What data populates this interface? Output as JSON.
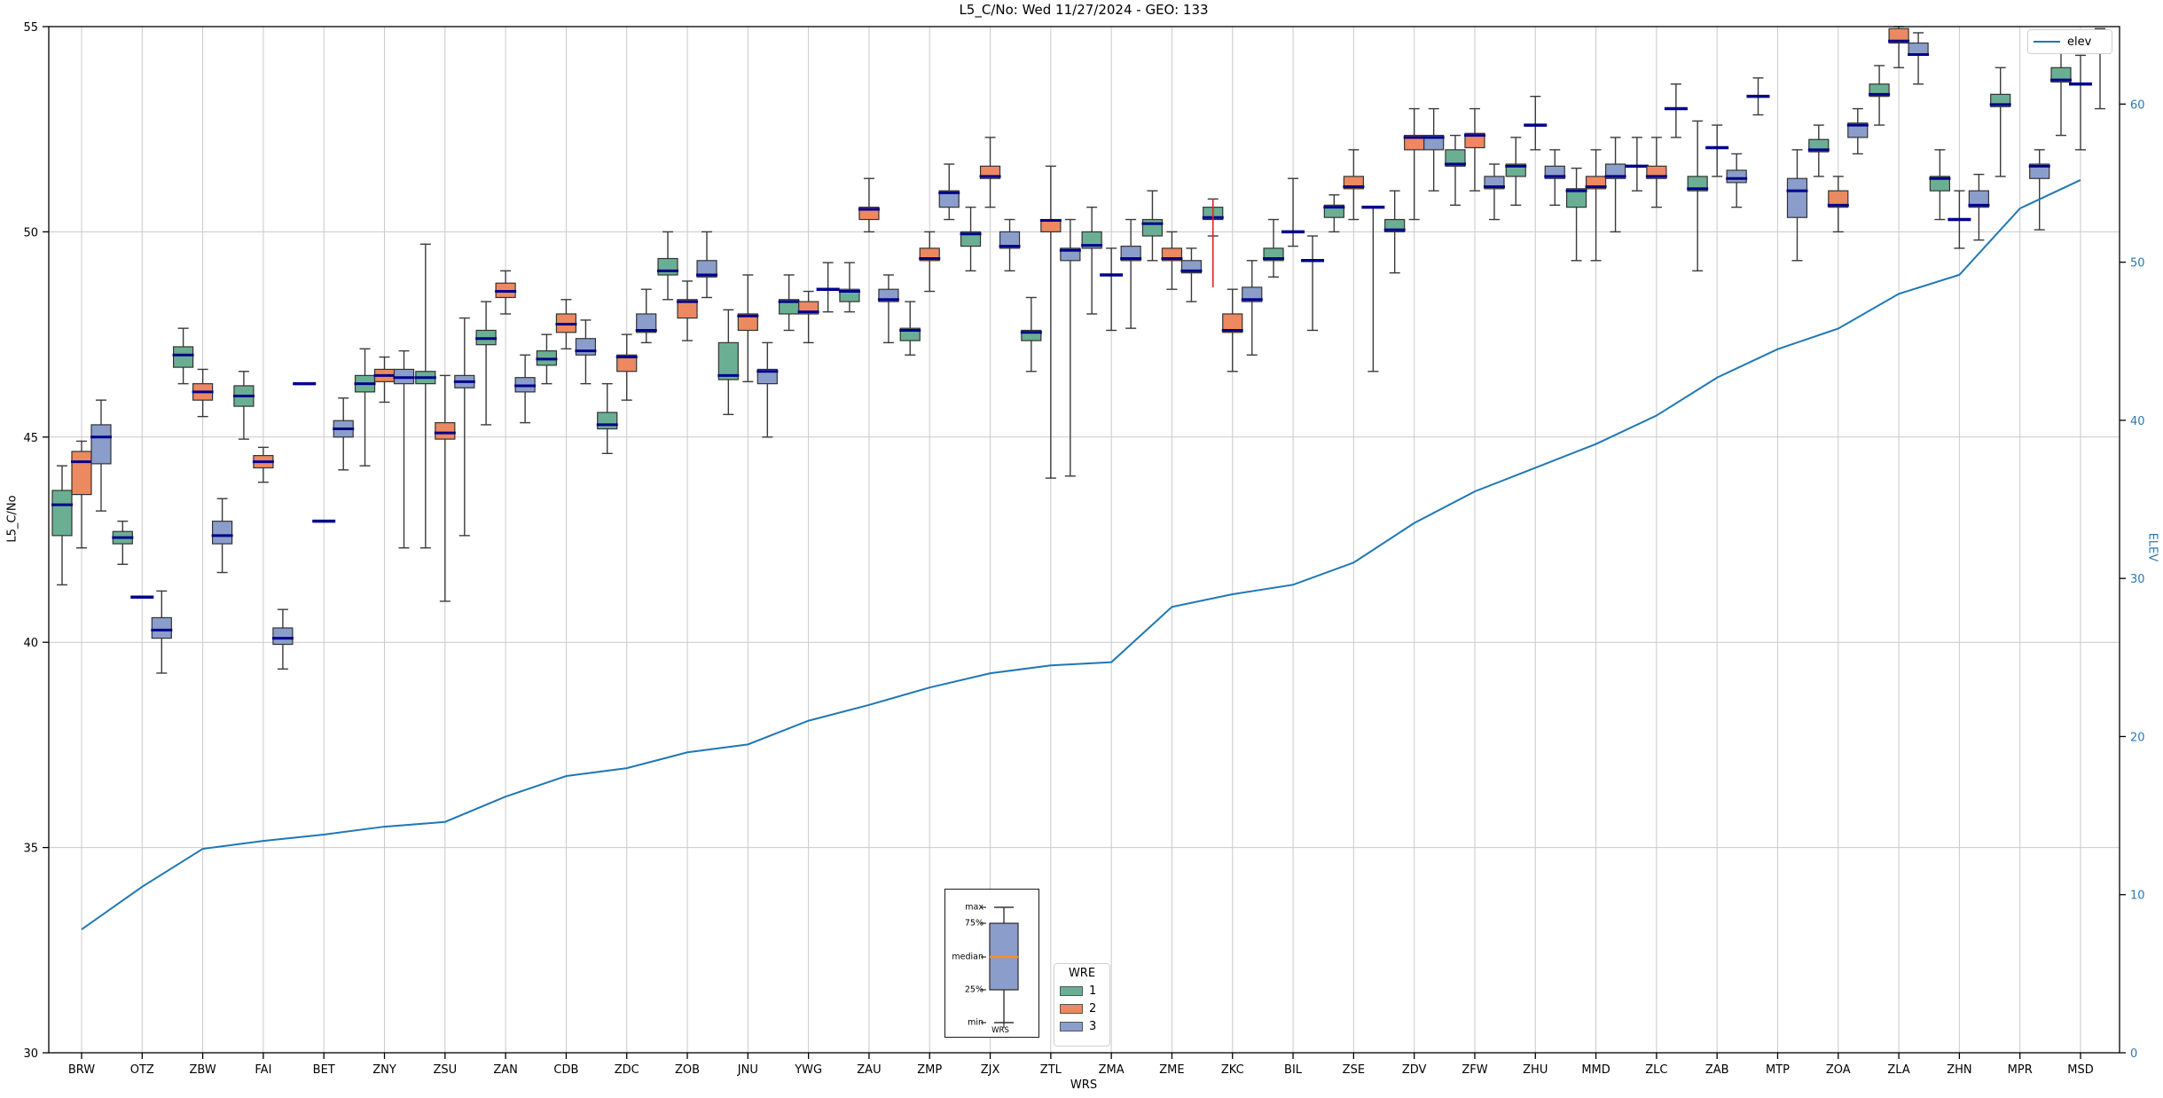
{
  "title": "L5_C/No: Wed 11/27/2024 - GEO: 133",
  "axes": {
    "left": {
      "label": "L5_C/No",
      "ticks": [
        55,
        50,
        45,
        40,
        35,
        30
      ],
      "range": [
        30,
        55
      ],
      "gridlines_at": [
        35,
        40,
        45,
        50
      ]
    },
    "right": {
      "label": "ELEV",
      "ticks": [
        60,
        50,
        40,
        30,
        20,
        10,
        0
      ],
      "range": [
        0,
        64.9
      ],
      "tick_color": "#2878b5"
    },
    "x": {
      "label": "WRS"
    }
  },
  "legend_elev": {
    "label": "elev",
    "color": "#1f77b4"
  },
  "wre_legend": {
    "title": "WRE",
    "entries": [
      {
        "label": "1",
        "color": "#6aaf93"
      },
      {
        "label": "2",
        "color": "#ec8960"
      },
      {
        "label": "3",
        "color": "#8b9dca"
      }
    ]
  },
  "inset": {
    "labels": [
      "max",
      "75%",
      "median",
      "25%",
      "min"
    ],
    "xlabel": "WRS",
    "box_color": "#8b9dca",
    "median_color": "#ff8c1a"
  },
  "colors": {
    "median": "#00008b",
    "box_edge": "#333333",
    "whisker": "#3a3a3a",
    "grid": "#c9c9c9",
    "annotation_red": "#e52222",
    "elev_line": "#1f77b4"
  },
  "chart_data": {
    "type": "boxplot+line",
    "title": "L5_C/No: Wed 11/27/2024 - GEO: 133",
    "xlabel": "WRS",
    "ylabel_left": "L5_C/No",
    "ylabel_right": "ELEV",
    "ylim_left": [
      30,
      55
    ],
    "ylim_right": [
      0,
      64.9
    ],
    "box_stats_format": "[lo_whisker, q1, median, q3, hi_whisker] or [lo_whisker, median, hi_whisker] for flat (degenerate) boxes",
    "wre_series": [
      "1",
      "2",
      "3"
    ],
    "stations": [
      {
        "name": "BRW",
        "elev": 7.8,
        "wre1": [
          41.4,
          42.6,
          43.35,
          43.7,
          44.3
        ],
        "wre2": [
          42.3,
          43.6,
          44.4,
          44.65,
          44.9
        ],
        "wre3": [
          43.2,
          44.35,
          45.0,
          45.3,
          45.9
        ]
      },
      {
        "name": "OTZ",
        "elev": 10.5,
        "wre1": [
          41.9,
          42.4,
          42.55,
          42.7,
          42.95
        ],
        "wre2": [
          41.1,
          41.1,
          41.1
        ],
        "wre3": [
          39.25,
          40.1,
          40.3,
          40.6,
          41.25
        ]
      },
      {
        "name": "ZBW",
        "elev": 12.9,
        "wre1": [
          46.3,
          46.7,
          47.0,
          47.2,
          47.65
        ],
        "wre2": [
          45.5,
          45.9,
          46.1,
          46.3,
          46.65
        ],
        "wre3": [
          41.7,
          42.4,
          42.6,
          42.95,
          43.5
        ]
      },
      {
        "name": "FAI",
        "elev": 13.4,
        "wre1": [
          44.95,
          45.75,
          46.0,
          46.25,
          46.6
        ],
        "wre2": [
          43.9,
          44.25,
          44.4,
          44.55,
          44.75
        ],
        "wre3": [
          39.35,
          39.95,
          40.1,
          40.35,
          40.8
        ]
      },
      {
        "name": "BET",
        "elev": 13.8,
        "wre1": [
          46.3,
          46.3,
          46.3
        ],
        "wre2": [
          42.95,
          42.95,
          42.95
        ],
        "wre3": [
          44.2,
          45.0,
          45.2,
          45.4,
          45.95
        ]
      },
      {
        "name": "ZNY",
        "elev": 14.3,
        "wre1": [
          44.3,
          46.1,
          46.3,
          46.5,
          47.15
        ],
        "wre2": [
          45.85,
          46.35,
          46.5,
          46.65,
          46.95
        ],
        "wre3": [
          42.3,
          46.3,
          46.45,
          46.65,
          47.1
        ]
      },
      {
        "name": "ZSU",
        "elev": 14.6,
        "wre1": [
          42.3,
          46.3,
          46.45,
          46.6,
          49.7
        ],
        "wre2": [
          41.0,
          44.95,
          45.1,
          45.35,
          46.5
        ],
        "wre3": [
          42.6,
          46.2,
          46.35,
          46.5,
          47.9
        ]
      },
      {
        "name": "ZAN",
        "elev": 16.2,
        "wre1": [
          45.3,
          47.25,
          47.4,
          47.6,
          48.3
        ],
        "wre2": [
          48.0,
          48.4,
          48.55,
          48.75,
          49.05
        ],
        "wre3": [
          45.35,
          46.1,
          46.25,
          46.45,
          47.0
        ]
      },
      {
        "name": "CDB",
        "elev": 17.5,
        "wre1": [
          46.3,
          46.75,
          46.9,
          47.1,
          47.5
        ],
        "wre2": [
          47.15,
          47.55,
          47.75,
          48.0,
          48.35
        ],
        "wre3": [
          46.3,
          47.0,
          47.1,
          47.4,
          47.85
        ]
      },
      {
        "name": "ZDC",
        "elev": 18.0,
        "wre1": [
          44.6,
          45.2,
          45.3,
          45.6,
          46.3
        ],
        "wre2": [
          45.9,
          46.6,
          46.95,
          47.0,
          47.5
        ],
        "wre3": [
          47.3,
          47.55,
          47.6,
          48.0,
          48.6
        ]
      },
      {
        "name": "ZOB",
        "elev": 19.0,
        "wre1": [
          48.35,
          48.95,
          49.05,
          49.35,
          50.0
        ],
        "wre2": [
          47.35,
          47.9,
          48.3,
          48.35,
          48.8
        ],
        "wre3": [
          48.4,
          48.9,
          48.95,
          49.3,
          50.0
        ]
      },
      {
        "name": "JNU",
        "elev": 19.5,
        "wre1": [
          45.55,
          46.4,
          46.5,
          47.3,
          48.1
        ],
        "wre2": [
          46.35,
          47.6,
          47.95,
          48.0,
          48.95
        ],
        "wre3": [
          45.0,
          46.3,
          46.6,
          46.65,
          47.3
        ]
      },
      {
        "name": "YWG",
        "elev": 21.0,
        "wre1": [
          47.6,
          48.0,
          48.3,
          48.35,
          48.95
        ],
        "wre2": [
          47.3,
          48.0,
          48.05,
          48.3,
          48.55
        ],
        "wre3": [
          48.05,
          48.6,
          49.25
        ]
      },
      {
        "name": "ZAU",
        "elev": 22.0,
        "wre1": [
          48.05,
          48.3,
          48.55,
          48.6,
          49.25
        ],
        "wre2": [
          50.0,
          50.3,
          50.55,
          50.6,
          51.3
        ],
        "wre3": [
          47.3,
          48.3,
          48.35,
          48.6,
          48.95
        ]
      },
      {
        "name": "ZMP",
        "elev": 23.1,
        "wre1": [
          47.0,
          47.35,
          47.6,
          47.65,
          48.3
        ],
        "wre2": [
          48.55,
          49.3,
          49.35,
          49.6,
          50.0
        ],
        "wre3": [
          50.3,
          50.6,
          50.95,
          51.0,
          51.65
        ]
      },
      {
        "name": "ZJX",
        "elev": 24.0,
        "wre1": [
          49.05,
          49.65,
          49.95,
          50.0,
          50.6
        ],
        "wre2": [
          50.6,
          51.3,
          51.35,
          51.6,
          52.3
        ],
        "wre3": [
          49.05,
          49.6,
          49.65,
          50.0,
          50.3
        ]
      },
      {
        "name": "ZTL",
        "elev": 24.5,
        "wre1": [
          46.6,
          47.35,
          47.55,
          47.6,
          48.4
        ],
        "wre2": [
          44.0,
          50.0,
          50.28,
          50.3,
          51.6
        ],
        "wre3": [
          44.05,
          49.3,
          49.55,
          49.6,
          50.3
        ]
      },
      {
        "name": "ZMA",
        "elev": 24.7,
        "wre1": [
          48.0,
          49.6,
          49.67,
          50.0,
          50.6
        ],
        "wre2": [
          47.6,
          48.95,
          49.6
        ],
        "wre3": [
          47.65,
          49.3,
          49.35,
          49.65,
          50.3
        ]
      },
      {
        "name": "ZME",
        "elev": 28.2,
        "wre1": [
          49.3,
          49.9,
          50.2,
          50.3,
          51.0
        ],
        "wre2": [
          48.6,
          49.3,
          49.35,
          49.6,
          50.0
        ],
        "wre3": [
          48.3,
          49.0,
          49.05,
          49.3,
          49.6
        ]
      },
      {
        "name": "ZKC",
        "elev": 29.0,
        "wre1": [
          49.9,
          50.3,
          50.35,
          50.6,
          50.8
        ],
        "wre2": [
          46.6,
          47.55,
          47.6,
          48.0,
          48.6
        ],
        "wre3": [
          47.0,
          48.3,
          48.35,
          48.65,
          49.3
        ]
      },
      {
        "name": "BIL",
        "elev": 29.6,
        "wre1": [
          48.9,
          49.3,
          49.35,
          49.6,
          50.3
        ],
        "wre2": [
          49.65,
          50.0,
          51.3
        ],
        "wre3": [
          47.6,
          49.3,
          49.9
        ]
      },
      {
        "name": "ZSE",
        "elev": 31.0,
        "wre1": [
          50.0,
          50.35,
          50.6,
          50.65,
          50.9
        ],
        "wre2": [
          50.3,
          51.05,
          51.1,
          51.35,
          52.0
        ],
        "wre3": [
          46.6,
          50.6,
          50.6
        ]
      },
      {
        "name": "ZDV",
        "elev": 33.5,
        "wre1": [
          49.0,
          50.0,
          50.05,
          50.3,
          51.0
        ],
        "wre2": [
          50.3,
          52.0,
          52.3,
          52.35,
          53.0
        ],
        "wre3": [
          51.0,
          52.0,
          52.3,
          52.35,
          53.0
        ]
      },
      {
        "name": "ZFW",
        "elev": 35.5,
        "wre1": [
          50.65,
          51.6,
          51.65,
          52.0,
          52.35
        ],
        "wre2": [
          51.0,
          52.05,
          52.35,
          52.4,
          53.0
        ],
        "wre3": [
          50.3,
          51.05,
          51.1,
          51.35,
          51.65
        ]
      },
      {
        "name": "ZHU",
        "elev": 37.0,
        "wre1": [
          50.65,
          51.35,
          51.6,
          51.65,
          52.3
        ],
        "wre2": [
          52.0,
          52.6,
          53.3
        ],
        "wre3": [
          50.65,
          51.3,
          51.35,
          51.6,
          52.0
        ]
      },
      {
        "name": "MMD",
        "elev": 38.5,
        "wre1": [
          49.3,
          50.6,
          51.0,
          51.05,
          51.55
        ],
        "wre2": [
          49.3,
          51.05,
          51.1,
          51.35,
          52.0
        ],
        "wre3": [
          50.0,
          51.3,
          51.35,
          51.65,
          52.3
        ]
      },
      {
        "name": "ZLC",
        "elev": 40.3,
        "wre1": [
          51.0,
          51.6,
          52.3
        ],
        "wre2": [
          50.6,
          51.3,
          51.35,
          51.6,
          52.3
        ],
        "wre3": [
          52.3,
          53.0,
          53.6
        ]
      },
      {
        "name": "ZAB",
        "elev": 42.7,
        "wre1": [
          49.05,
          51.0,
          51.05,
          51.35,
          52.7
        ],
        "wre2": [
          51.35,
          52.05,
          52.6
        ],
        "wre3": [
          50.6,
          51.2,
          51.3,
          51.5,
          51.9
        ]
      },
      {
        "name": "MTP",
        "elev": 44.5,
        "wre1": [
          52.85,
          53.3,
          53.75
        ],
        "wre2": null,
        "wre3": [
          49.3,
          50.35,
          51.0,
          51.3,
          52.0
        ]
      },
      {
        "name": "ZOA",
        "elev": 45.8,
        "wre1": [
          51.35,
          51.95,
          52.0,
          52.25,
          52.6
        ],
        "wre2": [
          50.0,
          50.6,
          50.65,
          51.0,
          51.35
        ],
        "wre3": [
          51.9,
          52.3,
          52.6,
          52.65,
          53.0
        ]
      },
      {
        "name": "ZLA",
        "elev": 48.0,
        "wre1": [
          52.6,
          53.3,
          53.35,
          53.6,
          54.05
        ],
        "wre2": [
          54.0,
          54.6,
          54.65,
          54.95,
          55.0
        ],
        "wre3": [
          53.6,
          54.3,
          54.32,
          54.6,
          54.85
        ]
      },
      {
        "name": "ZHN",
        "elev": 49.2,
        "wre1": [
          50.3,
          51.0,
          51.3,
          51.35,
          52.0
        ],
        "wre2": [
          49.6,
          50.3,
          51.0
        ],
        "wre3": [
          49.8,
          50.6,
          50.65,
          51.0,
          51.4
        ]
      },
      {
        "name": "MPR",
        "elev": 53.4,
        "wre1": [
          51.35,
          53.05,
          53.1,
          53.35,
          54.0
        ],
        "wre2": null,
        "wre3": [
          50.05,
          51.3,
          51.6,
          51.65,
          52.0
        ]
      },
      {
        "name": "MSD",
        "elev": 55.2,
        "wre1": [
          52.35,
          53.65,
          53.7,
          54.0,
          54.6
        ],
        "wre2": [
          52.0,
          53.6,
          54.3
        ],
        "wre3": [
          53.0,
          54.35,
          54.4,
          54.65,
          54.95
        ]
      }
    ],
    "annotations": [
      {
        "type": "red-vline",
        "station": "ZKC",
        "wre": "1",
        "from": 48.65,
        "to": 50.8
      }
    ],
    "legend_position": "upper right",
    "grid": true
  }
}
